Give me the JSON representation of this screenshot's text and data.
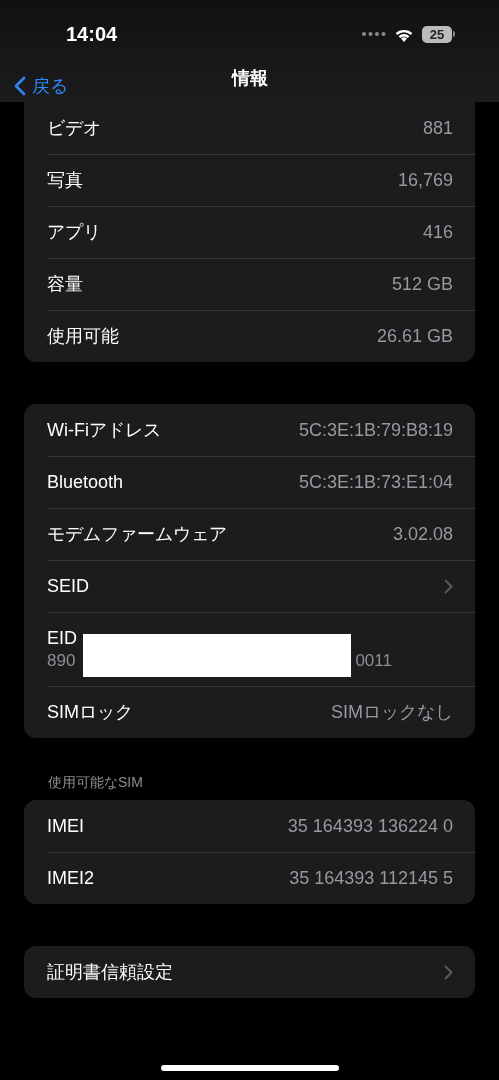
{
  "status_bar": {
    "time": "14:04",
    "battery": "25"
  },
  "nav": {
    "back": "戻る",
    "title": "情報"
  },
  "groups": [
    {
      "rows": [
        {
          "kind": "value",
          "label": "ビデオ",
          "value": "881"
        },
        {
          "kind": "value",
          "label": "写真",
          "value": "16,769"
        },
        {
          "kind": "value",
          "label": "アプリ",
          "value": "416"
        },
        {
          "kind": "value",
          "label": "容量",
          "value": "512 GB"
        },
        {
          "kind": "value",
          "label": "使用可能",
          "value": "26.61 GB"
        }
      ]
    },
    {
      "rows": [
        {
          "kind": "value",
          "label": "Wi-Fiアドレス",
          "value": "5C:3E:1B:79:B8:19"
        },
        {
          "kind": "value",
          "label": "Bluetooth",
          "value": "5C:3E:1B:73:E1:04"
        },
        {
          "kind": "value",
          "label": "モデムファームウェア",
          "value": "3.02.08"
        },
        {
          "kind": "chevron",
          "label": "SEID"
        },
        {
          "kind": "eid",
          "label": "EID",
          "value_start": "890",
          "value_end": "0011"
        },
        {
          "kind": "value",
          "label": "SIMロック",
          "value": "SIMロックなし"
        }
      ]
    },
    {
      "header": "使用可能なSIM",
      "rows": [
        {
          "kind": "value",
          "label": "IMEI",
          "value": "35 164393 136224 0"
        },
        {
          "kind": "value",
          "label": "IMEI2",
          "value": "35 164393 112145 5"
        }
      ]
    },
    {
      "rows": [
        {
          "kind": "chevron",
          "label": "証明書信頼設定"
        }
      ]
    }
  ]
}
